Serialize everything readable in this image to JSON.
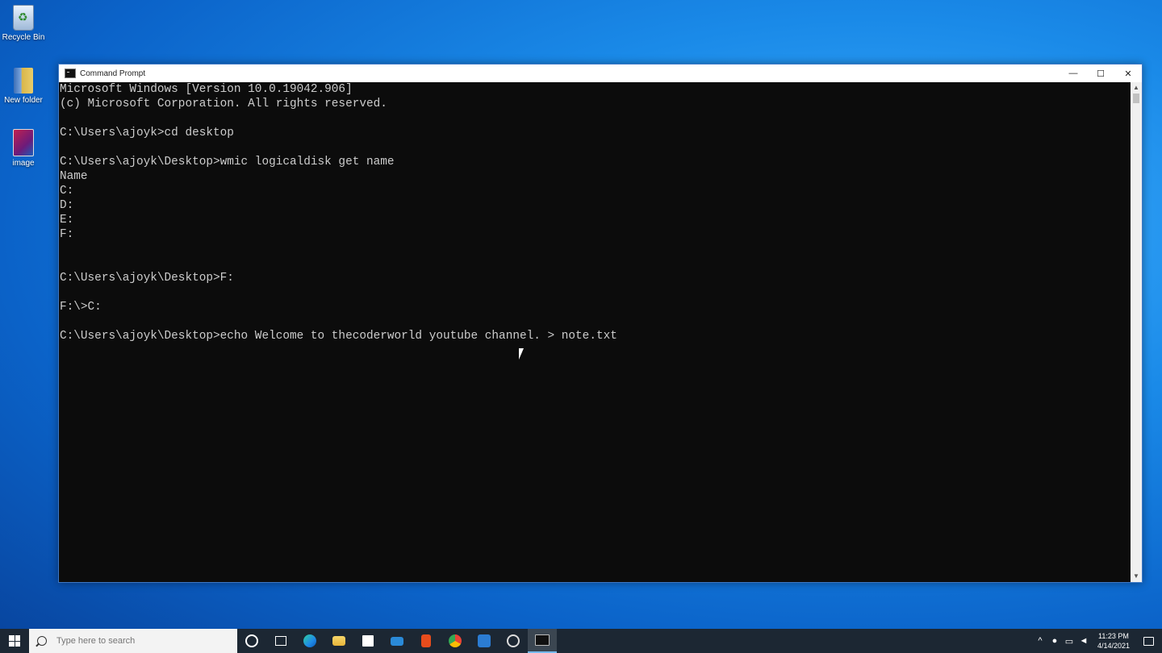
{
  "desktop": {
    "icons": [
      {
        "label": "Recycle Bin",
        "icon": "recycle-bin-icon"
      },
      {
        "label": "New folder",
        "icon": "folder-icon"
      },
      {
        "label": "image",
        "icon": "image-file-icon"
      }
    ]
  },
  "window": {
    "title": "Command Prompt",
    "controls": {
      "minimize": "—",
      "maximize": "☐",
      "close": "✕"
    },
    "console_lines": [
      "Microsoft Windows [Version 10.0.19042.906]",
      "(c) Microsoft Corporation. All rights reserved.",
      "",
      "C:\\Users\\ajoyk>cd desktop",
      "",
      "C:\\Users\\ajoyk\\Desktop>wmic logicaldisk get name",
      "Name",
      "C:",
      "D:",
      "E:",
      "F:",
      "",
      "",
      "C:\\Users\\ajoyk\\Desktop>F:",
      "",
      "F:\\>C:",
      "",
      "C:\\Users\\ajoyk\\Desktop>echo Welcome to thecoderworld youtube channel. > note.txt"
    ]
  },
  "taskbar": {
    "search_placeholder": "Type here to search",
    "apps": [
      {
        "name": "cortana",
        "icon": "cortana-icon",
        "color": "#ffffff"
      },
      {
        "name": "task-view",
        "icon": "task-view-icon",
        "color": "#ffffff"
      },
      {
        "name": "edge",
        "icon": "edge-icon",
        "color": "#1fa0e8"
      },
      {
        "name": "file-explorer",
        "icon": "folder-icon",
        "color": "#f4c542"
      },
      {
        "name": "store",
        "icon": "store-icon",
        "color": "#ffffff"
      },
      {
        "name": "mail",
        "icon": "mail-icon",
        "color": "#2a8ad8"
      },
      {
        "name": "office",
        "icon": "office-icon",
        "color": "#e74c1c"
      },
      {
        "name": "chrome",
        "icon": "chrome-icon",
        "color": "#34a853"
      },
      {
        "name": "word",
        "icon": "word-icon",
        "color": "#2b7cd3"
      },
      {
        "name": "obs",
        "icon": "obs-icon",
        "color": "#dddddd"
      },
      {
        "name": "command-prompt",
        "icon": "terminal-icon",
        "color": "#cccccc"
      }
    ],
    "clock": {
      "time": "11:23 PM",
      "date": "4/14/2021"
    }
  }
}
